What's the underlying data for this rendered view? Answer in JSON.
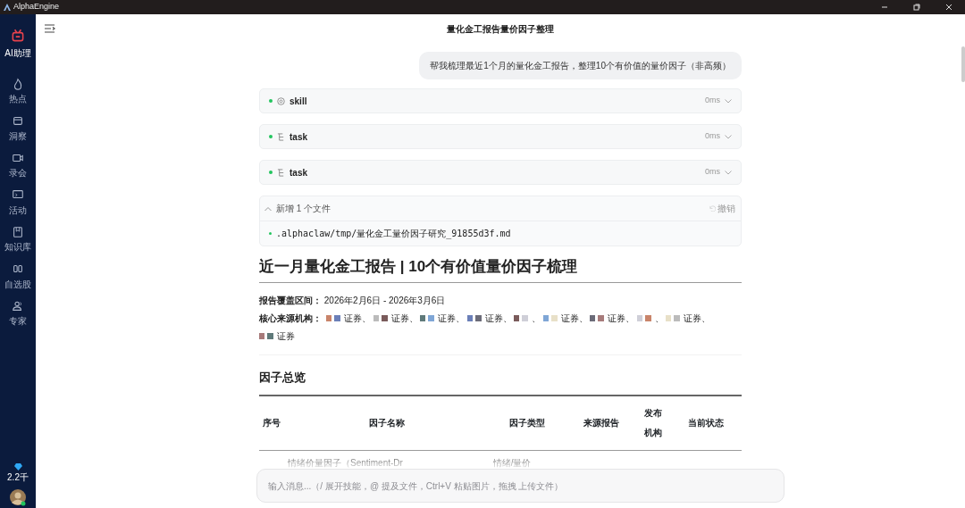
{
  "window": {
    "title": "AlphaEngine"
  },
  "sidebar": {
    "items": [
      {
        "label": "AI助理",
        "selected": true
      },
      {
        "label": "热点",
        "selected": false
      },
      {
        "label": "洞察",
        "selected": false
      },
      {
        "label": "录会",
        "selected": false
      },
      {
        "label": "活动",
        "selected": false
      },
      {
        "label": "知识库",
        "selected": false
      },
      {
        "label": "自选股",
        "selected": false
      },
      {
        "label": "专家",
        "selected": false
      }
    ],
    "credits": "2.2千"
  },
  "header": {
    "title": "量化金工报告量价因子整理"
  },
  "user_message": "帮我梳理最近1个月的量化金工报告，整理10个有价值的量价因子（非高频）",
  "steps": [
    {
      "kind": "skill",
      "label": "skill",
      "duration": "0ms",
      "done": true
    },
    {
      "kind": "task",
      "label": "task",
      "duration": "0ms",
      "done": true
    },
    {
      "kind": "task",
      "label": "task",
      "duration": "0ms",
      "done": true
    }
  ],
  "files": {
    "summary": "新增 1 个文件",
    "undo": "撤销",
    "expanded": true,
    "items": [
      ".alphaclaw/tmp/量化金工量价因子研究_91855d3f.md"
    ]
  },
  "report": {
    "title": "近一月量化金工报告 | 10个有价值量价因子梳理",
    "period_label": "报告覆盖区间：",
    "period": "2026年2月6日 - 2026年3月6日",
    "sources_label": "核心来源机构：",
    "sources": [
      "证券、",
      "证券、",
      "证券、",
      "证券、",
      "、",
      "证券、",
      "证券、",
      "、",
      "证券、",
      "证券"
    ],
    "section": "因子总览",
    "table": {
      "columns": [
        "序号",
        "因子名称",
        "因子类型",
        "来源报告",
        "发布机构",
        "当前状态"
      ],
      "rows": [
        [
          "",
          "情绪价量因子（Sentiment-Dr",
          "情绪/量价",
          "",
          "",
          ""
        ]
      ]
    }
  },
  "composer": {
    "placeholder": "输入消息...（/ 展开技能，@ 提及文件，Ctrl+V 粘贴图片，拖拽 上传文件）"
  }
}
